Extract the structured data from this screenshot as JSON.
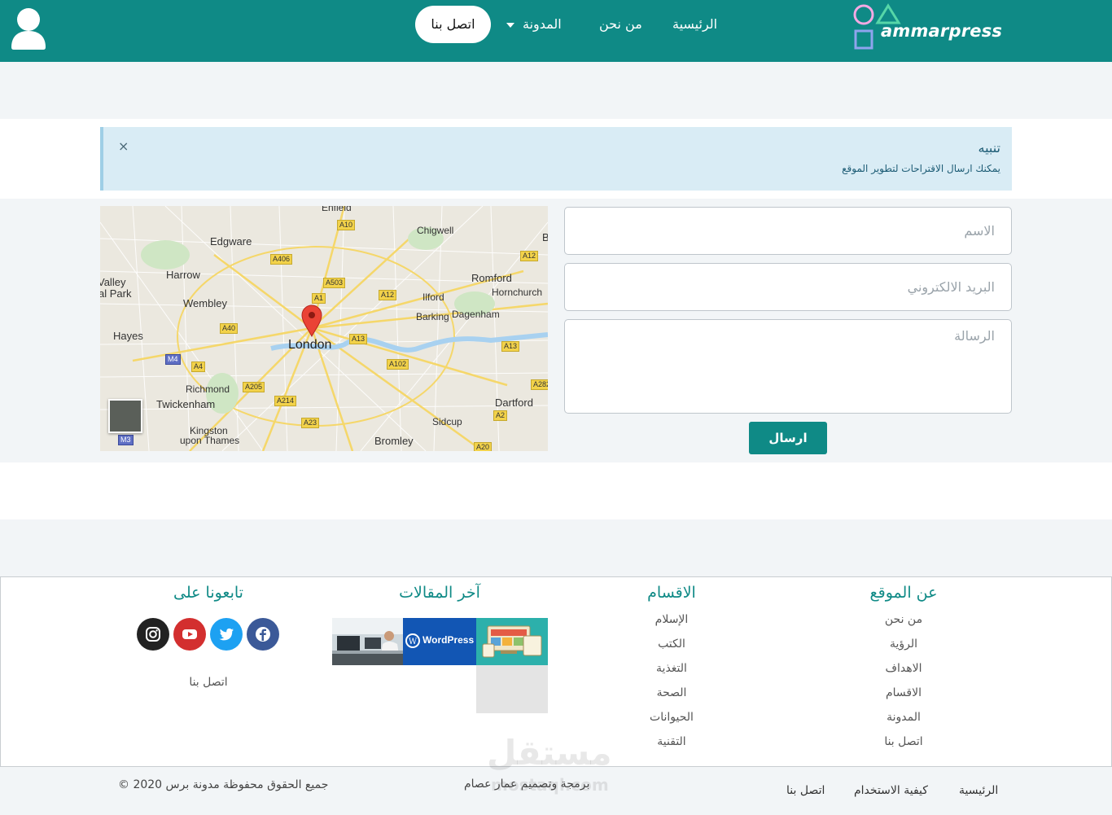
{
  "header": {
    "logo_text": "ammarpress",
    "nav": {
      "home": "الرئيسية",
      "about": "من نحن",
      "blog": "المدونة",
      "contact": "اتصل بنا"
    },
    "brand_color": "#0f8a86",
    "user_icon": "user-icon"
  },
  "alert": {
    "title": "تنبيه",
    "text": "يمكنك ارسال الاقتراحات لتطوير الموقع",
    "close": "×"
  },
  "map": {
    "labels": {
      "london": "London",
      "edgware": "Edgware",
      "harrow": "Harrow",
      "wembley": "Wembley",
      "hayes": "Hayes",
      "richmond": "Richmond",
      "twickenham": "Twickenham",
      "kingston": "Kingston",
      "upon_thames": "upon Thames",
      "chigwell": "Chigwell",
      "romford": "Romford",
      "hornchurch": "Hornchurch",
      "ilford": "Ilford",
      "barking": "Barking",
      "dagenham": "Dagenham",
      "dartford": "Dartford",
      "sidcup": "Sidcup",
      "bromley": "Bromley",
      "enfield": "Enfield",
      "valley": "Valley",
      "park": "al Park",
      "b": "B"
    },
    "roads": {
      "a10": "A10",
      "a406": "A406",
      "a503": "A503",
      "a1": "A1",
      "a12a": "A12",
      "a12b": "A12",
      "a40": "A40",
      "m4": "M4",
      "a4": "A4",
      "a13a": "A13",
      "a13b": "A13",
      "a102": "A102",
      "a205": "A205",
      "a214": "A214",
      "a23": "A23",
      "a2": "A2",
      "a20": "A20",
      "a282": "A282",
      "m3": "M3"
    }
  },
  "form": {
    "name_placeholder": "الاسم",
    "email_placeholder": "البريد الالكتروني",
    "message_placeholder": "الرسالة",
    "send_label": "ارسال"
  },
  "footer": {
    "about": {
      "title": "عن الموقع",
      "links": [
        "من نحن",
        "الرؤية",
        "الاهداف",
        "الاقسام",
        "المدونة",
        "اتصل بنا"
      ]
    },
    "categories": {
      "title": "الاقسام",
      "links": [
        "الإسلام",
        "الكتب",
        "التغذية",
        "الصحة",
        "الحيوانات",
        "التقنية"
      ]
    },
    "latest": {
      "title": "آخر المقالات",
      "wordpress_text": "WordPress"
    },
    "follow": {
      "title": "تابعونا على",
      "contact": "اتصل بنا",
      "icons": [
        "facebook-icon",
        "twitter-icon",
        "youtube-icon",
        "instagram-icon"
      ],
      "colors": {
        "facebook": "#3b5998",
        "twitter": "#1da1f2",
        "youtube": "#e62117",
        "instagram": "#222222"
      }
    }
  },
  "bottom": {
    "home": "الرئيسية",
    "howto": "كيفية الاستخدام",
    "contact": "اتصل بنا",
    "credits": "برمجة وتصميم عمار عصام",
    "copyright": "جميع الحقوق محفوظة مدونة برس 2020 ©"
  },
  "watermark": {
    "arabic": "مستقل",
    "latin": "mostaql.com"
  }
}
